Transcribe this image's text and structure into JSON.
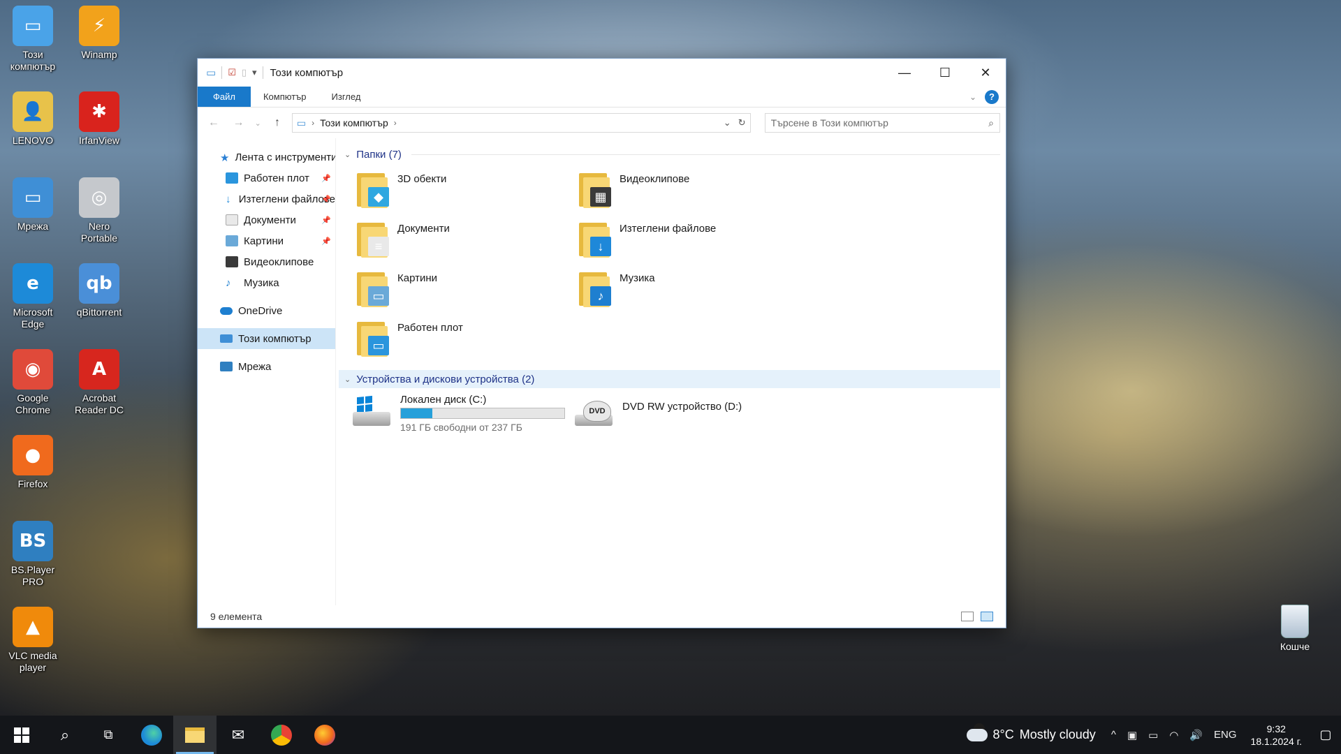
{
  "desktop": {
    "icons": [
      {
        "label": "Този\nкомпютър",
        "color": "#4aa3e8",
        "glyph": "▭"
      },
      {
        "label": "Winamp",
        "color": "#f2a21b",
        "glyph": "⚡"
      },
      {
        "label": "LENOVO",
        "color": "#e8c24a",
        "glyph": "👤"
      },
      {
        "label": "IrfanView",
        "color": "#d9231d",
        "glyph": "✱"
      },
      {
        "label": "Мрежа",
        "color": "#3f8fd6",
        "glyph": "▭"
      },
      {
        "label": "Nero\nPortable",
        "color": "#c5c8cc",
        "glyph": "◎"
      },
      {
        "label": "Microsoft\nEdge",
        "color": "#1d8ad8",
        "glyph": "e"
      },
      {
        "label": "qBittorrent",
        "color": "#4a8fd8",
        "glyph": "qb"
      },
      {
        "label": "Google\nChrome",
        "color": "#e04a3a",
        "glyph": "◉"
      },
      {
        "label": "Acrobat\nReader DC",
        "color": "#d7261e",
        "glyph": "A"
      },
      {
        "label": "Firefox",
        "color": "#f06a1d",
        "glyph": "●"
      },
      {
        "label": "BS.Player\nPRO",
        "color": "#2f7fc0",
        "glyph": "BS"
      },
      {
        "label": "VLC media\nplayer",
        "color": "#f08a0b",
        "glyph": "▲"
      }
    ],
    "recycle_label": "Кошче"
  },
  "window": {
    "title": "Този компютър",
    "ribbon_tabs": [
      "Файл",
      "Компютър",
      "Изглед"
    ],
    "address_path": "Този компютър",
    "search_placeholder": "Търсене в Този компютър",
    "nav": {
      "quick_access": "Лента с инструменти за бърз достъп",
      "items": [
        "Работен плот",
        "Изтеглени файлове",
        "Документи",
        "Картини",
        "Видеоклипове",
        "Музика"
      ],
      "onedrive": "OneDrive",
      "this_pc": "Този компютър",
      "network": "Мрежа"
    },
    "folders_header": "Папки (7)",
    "folders": [
      {
        "name": "3D обекти",
        "glyph_color": "#2fa7e0",
        "glyph": "◆"
      },
      {
        "name": "Видеоклипове",
        "glyph_color": "#3a3a3a",
        "glyph": "▦"
      },
      {
        "name": "Документи",
        "glyph_color": "#e9e9e9",
        "glyph": "≡"
      },
      {
        "name": "Изтеглени файлове",
        "glyph_color": "#1e88d9",
        "glyph": "↓"
      },
      {
        "name": "Картини",
        "glyph_color": "#6aa9d8",
        "glyph": "▭"
      },
      {
        "name": "Музика",
        "glyph_color": "#1e7fd0",
        "glyph": "♪"
      },
      {
        "name": "Работен плот",
        "glyph_color": "#2a95dd",
        "glyph": "▭"
      }
    ],
    "devices_header": "Устройства и дискови устройства (2)",
    "drives": [
      {
        "name": "Локален диск (C:)",
        "free": "191 ГБ свободни от 237 ГБ",
        "used_fraction": 0.194
      },
      {
        "name": "DVD RW устройство (D:)",
        "badge": "DVD"
      }
    ],
    "status": "9 елемента"
  },
  "taskbar": {
    "weather_temp": "8°C",
    "weather_text": "Mostly cloudy",
    "lang": "ENG",
    "time": "9:32",
    "date": "18.1.2024 г."
  }
}
